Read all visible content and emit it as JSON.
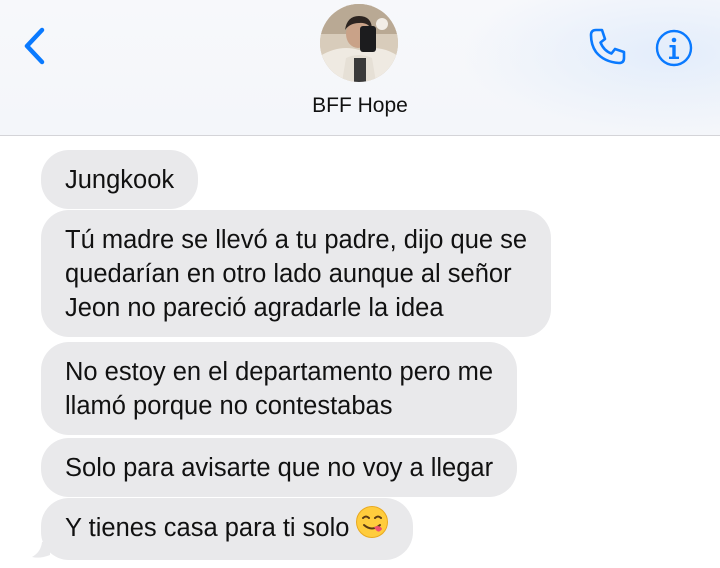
{
  "header": {
    "contact_name": "BFF Hope",
    "back_icon": "chevron-left-icon",
    "phone_icon": "phone-icon",
    "info_icon": "info-icon",
    "accent_color": "#0a7aff"
  },
  "messages": [
    {
      "lines": [
        "Jungkook"
      ]
    },
    {
      "lines": [
        "Tú madre se llevó a tu padre, dijo que se",
        "quedarían en otro lado aunque al señor",
        "Jeon no pareció agradarle la idea"
      ]
    },
    {
      "lines": [
        "No estoy en el departamento pero me",
        "llamó porque no contestabas"
      ]
    },
    {
      "lines": [
        "Solo para avisarte que no voy a llegar"
      ]
    },
    {
      "lines": [
        "Y tienes casa para ti solo"
      ],
      "emoji": "face-savoring-food-icon"
    }
  ],
  "colors": {
    "bubble_received": "#e9e9eb",
    "text": "#111111"
  }
}
